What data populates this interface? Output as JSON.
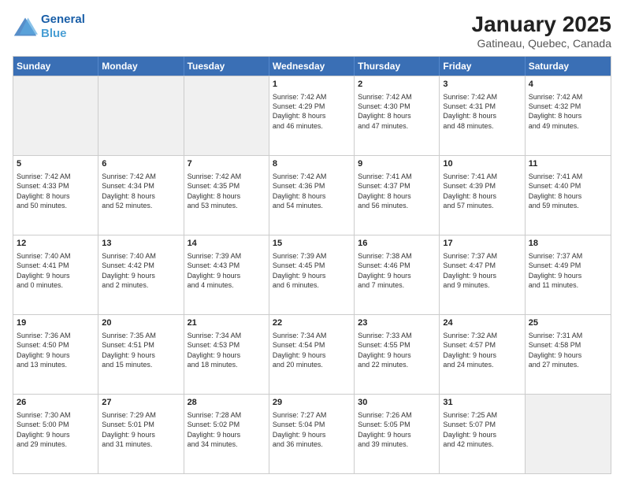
{
  "header": {
    "logo_line1": "General",
    "logo_line2": "Blue",
    "title": "January 2025",
    "subtitle": "Gatineau, Quebec, Canada"
  },
  "days": [
    "Sunday",
    "Monday",
    "Tuesday",
    "Wednesday",
    "Thursday",
    "Friday",
    "Saturday"
  ],
  "rows": [
    [
      {
        "day": "",
        "text": ""
      },
      {
        "day": "",
        "text": ""
      },
      {
        "day": "",
        "text": ""
      },
      {
        "day": "1",
        "text": "Sunrise: 7:42 AM\nSunset: 4:29 PM\nDaylight: 8 hours\nand 46 minutes."
      },
      {
        "day": "2",
        "text": "Sunrise: 7:42 AM\nSunset: 4:30 PM\nDaylight: 8 hours\nand 47 minutes."
      },
      {
        "day": "3",
        "text": "Sunrise: 7:42 AM\nSunset: 4:31 PM\nDaylight: 8 hours\nand 48 minutes."
      },
      {
        "day": "4",
        "text": "Sunrise: 7:42 AM\nSunset: 4:32 PM\nDaylight: 8 hours\nand 49 minutes."
      }
    ],
    [
      {
        "day": "5",
        "text": "Sunrise: 7:42 AM\nSunset: 4:33 PM\nDaylight: 8 hours\nand 50 minutes."
      },
      {
        "day": "6",
        "text": "Sunrise: 7:42 AM\nSunset: 4:34 PM\nDaylight: 8 hours\nand 52 minutes."
      },
      {
        "day": "7",
        "text": "Sunrise: 7:42 AM\nSunset: 4:35 PM\nDaylight: 8 hours\nand 53 minutes."
      },
      {
        "day": "8",
        "text": "Sunrise: 7:42 AM\nSunset: 4:36 PM\nDaylight: 8 hours\nand 54 minutes."
      },
      {
        "day": "9",
        "text": "Sunrise: 7:41 AM\nSunset: 4:37 PM\nDaylight: 8 hours\nand 56 minutes."
      },
      {
        "day": "10",
        "text": "Sunrise: 7:41 AM\nSunset: 4:39 PM\nDaylight: 8 hours\nand 57 minutes."
      },
      {
        "day": "11",
        "text": "Sunrise: 7:41 AM\nSunset: 4:40 PM\nDaylight: 8 hours\nand 59 minutes."
      }
    ],
    [
      {
        "day": "12",
        "text": "Sunrise: 7:40 AM\nSunset: 4:41 PM\nDaylight: 9 hours\nand 0 minutes."
      },
      {
        "day": "13",
        "text": "Sunrise: 7:40 AM\nSunset: 4:42 PM\nDaylight: 9 hours\nand 2 minutes."
      },
      {
        "day": "14",
        "text": "Sunrise: 7:39 AM\nSunset: 4:43 PM\nDaylight: 9 hours\nand 4 minutes."
      },
      {
        "day": "15",
        "text": "Sunrise: 7:39 AM\nSunset: 4:45 PM\nDaylight: 9 hours\nand 6 minutes."
      },
      {
        "day": "16",
        "text": "Sunrise: 7:38 AM\nSunset: 4:46 PM\nDaylight: 9 hours\nand 7 minutes."
      },
      {
        "day": "17",
        "text": "Sunrise: 7:37 AM\nSunset: 4:47 PM\nDaylight: 9 hours\nand 9 minutes."
      },
      {
        "day": "18",
        "text": "Sunrise: 7:37 AM\nSunset: 4:49 PM\nDaylight: 9 hours\nand 11 minutes."
      }
    ],
    [
      {
        "day": "19",
        "text": "Sunrise: 7:36 AM\nSunset: 4:50 PM\nDaylight: 9 hours\nand 13 minutes."
      },
      {
        "day": "20",
        "text": "Sunrise: 7:35 AM\nSunset: 4:51 PM\nDaylight: 9 hours\nand 15 minutes."
      },
      {
        "day": "21",
        "text": "Sunrise: 7:34 AM\nSunset: 4:53 PM\nDaylight: 9 hours\nand 18 minutes."
      },
      {
        "day": "22",
        "text": "Sunrise: 7:34 AM\nSunset: 4:54 PM\nDaylight: 9 hours\nand 20 minutes."
      },
      {
        "day": "23",
        "text": "Sunrise: 7:33 AM\nSunset: 4:55 PM\nDaylight: 9 hours\nand 22 minutes."
      },
      {
        "day": "24",
        "text": "Sunrise: 7:32 AM\nSunset: 4:57 PM\nDaylight: 9 hours\nand 24 minutes."
      },
      {
        "day": "25",
        "text": "Sunrise: 7:31 AM\nSunset: 4:58 PM\nDaylight: 9 hours\nand 27 minutes."
      }
    ],
    [
      {
        "day": "26",
        "text": "Sunrise: 7:30 AM\nSunset: 5:00 PM\nDaylight: 9 hours\nand 29 minutes."
      },
      {
        "day": "27",
        "text": "Sunrise: 7:29 AM\nSunset: 5:01 PM\nDaylight: 9 hours\nand 31 minutes."
      },
      {
        "day": "28",
        "text": "Sunrise: 7:28 AM\nSunset: 5:02 PM\nDaylight: 9 hours\nand 34 minutes."
      },
      {
        "day": "29",
        "text": "Sunrise: 7:27 AM\nSunset: 5:04 PM\nDaylight: 9 hours\nand 36 minutes."
      },
      {
        "day": "30",
        "text": "Sunrise: 7:26 AM\nSunset: 5:05 PM\nDaylight: 9 hours\nand 39 minutes."
      },
      {
        "day": "31",
        "text": "Sunrise: 7:25 AM\nSunset: 5:07 PM\nDaylight: 9 hours\nand 42 minutes."
      },
      {
        "day": "",
        "text": ""
      }
    ]
  ],
  "shading": {
    "row0": [
      true,
      true,
      true,
      false,
      false,
      false,
      false
    ],
    "row4": [
      false,
      false,
      false,
      false,
      false,
      false,
      true
    ]
  }
}
